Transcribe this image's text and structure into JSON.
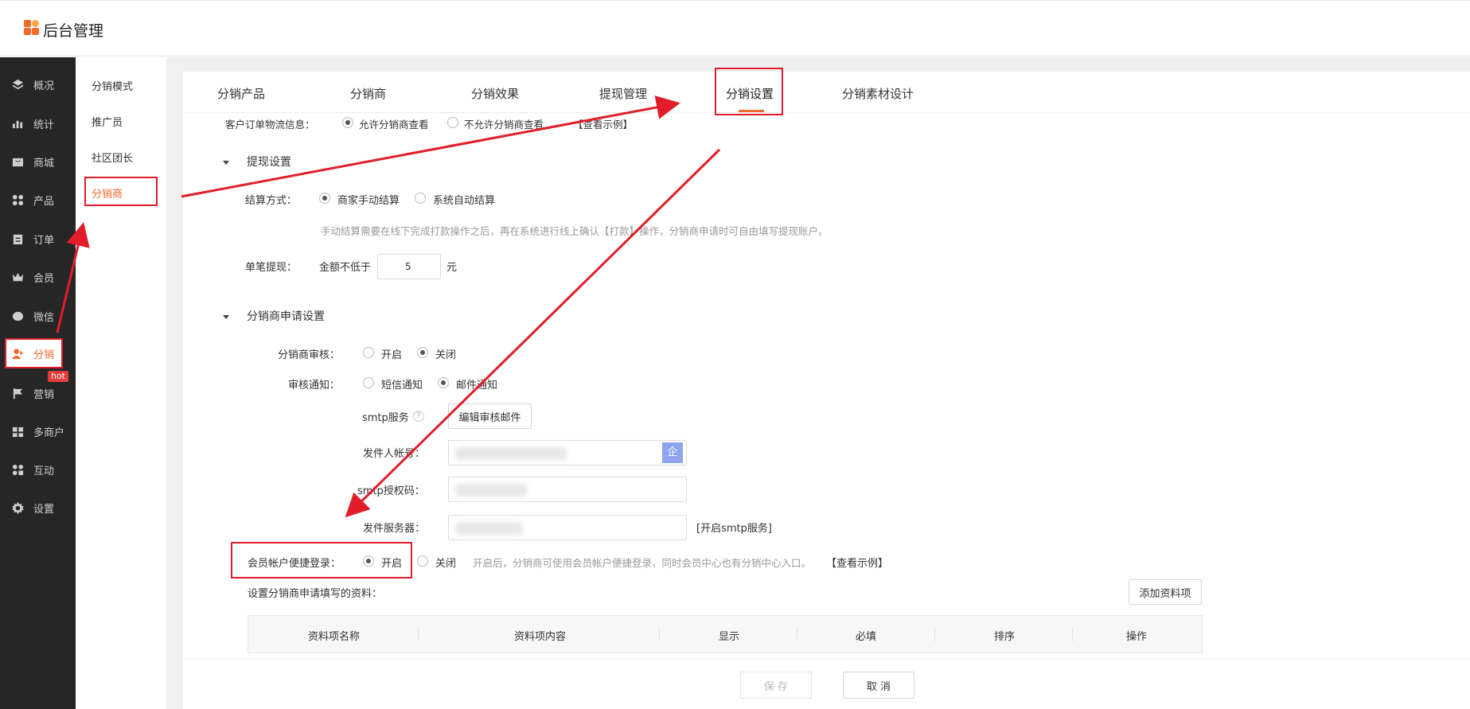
{
  "header": {
    "brand": "后台管理"
  },
  "sidebar": {
    "items": [
      {
        "label": "概况",
        "icon": "layers-icon"
      },
      {
        "label": "统计",
        "icon": "chart-icon"
      },
      {
        "label": "商城",
        "icon": "shop-icon"
      },
      {
        "label": "产品",
        "icon": "grid-icon"
      },
      {
        "label": "订单",
        "icon": "clipboard-icon"
      },
      {
        "label": "会员",
        "icon": "crown-icon"
      },
      {
        "label": "微信",
        "icon": "wechat-icon"
      },
      {
        "label": "分销",
        "icon": "user-share-icon"
      },
      {
        "label": "营销",
        "icon": "flag-icon"
      },
      {
        "label": "多商户",
        "icon": "store-icon"
      },
      {
        "label": "互动",
        "icon": "interact-icon"
      },
      {
        "label": "设置",
        "icon": "gear-icon"
      }
    ],
    "hot_badge": "hot"
  },
  "submenu": {
    "items": [
      "分销模式",
      "推广员",
      "社区团长",
      "分销商"
    ]
  },
  "tabs": [
    "分销产品",
    "分销商",
    "分销效果",
    "提现管理",
    "分销设置",
    "分销素材设计"
  ],
  "logistics": {
    "label": "客户订单物流信息：",
    "opt_allow": "允许分销商查看",
    "opt_deny": "不允许分销商查看",
    "example": "【查看示例】"
  },
  "withdraw": {
    "title": "提现设置",
    "settle_label": "结算方式：",
    "settle_manual": "商家手动结算",
    "settle_auto": "系统自动结算",
    "settle_hint": "手动结算需要在线下完成打款操作之后，再在系统进行线上确认【打款】操作，分销商申请时可自由填写提现账户。",
    "single_label": "单笔提现：",
    "min_label": "金额不低于",
    "min_value": "5",
    "unit": "元"
  },
  "apply": {
    "title": "分销商申请设置",
    "review_label": "分销商审核：",
    "review_on": "开启",
    "review_off": "关闭",
    "notify_label": "审核通知：",
    "notify_sms": "短信通知",
    "notify_mail": "邮件通知",
    "smtp_label": "smtp服务",
    "help": "?",
    "edit_mail_btn": "编辑审核邮件",
    "sender_label": "发件人帐号：",
    "sender_suffix": "企",
    "auth_label": "smtp授权码：",
    "server_label": "发件服务器：",
    "open_smtp": "[开启smtp服务]",
    "quick_login_label": "会员帐户便捷登录：",
    "quick_on": "开启",
    "quick_off": "关闭",
    "quick_hint": "开启后，分销商可使用会员帐户便捷登录，同时会员中心也有分销中心入口。",
    "quick_example": "【查看示例】",
    "fields_label": "设置分销商申请填写的资料：",
    "add_field_btn": "添加资料项"
  },
  "table": {
    "headers": [
      "资料项名称",
      "资料项内容",
      "显示",
      "必填",
      "排序",
      "操作"
    ]
  },
  "footer": {
    "save": "保 存",
    "cancel": "取 消"
  },
  "colors": {
    "accent": "#f06a2c",
    "annotation": "#e11d2a",
    "sidebar_bg": "#262626"
  }
}
